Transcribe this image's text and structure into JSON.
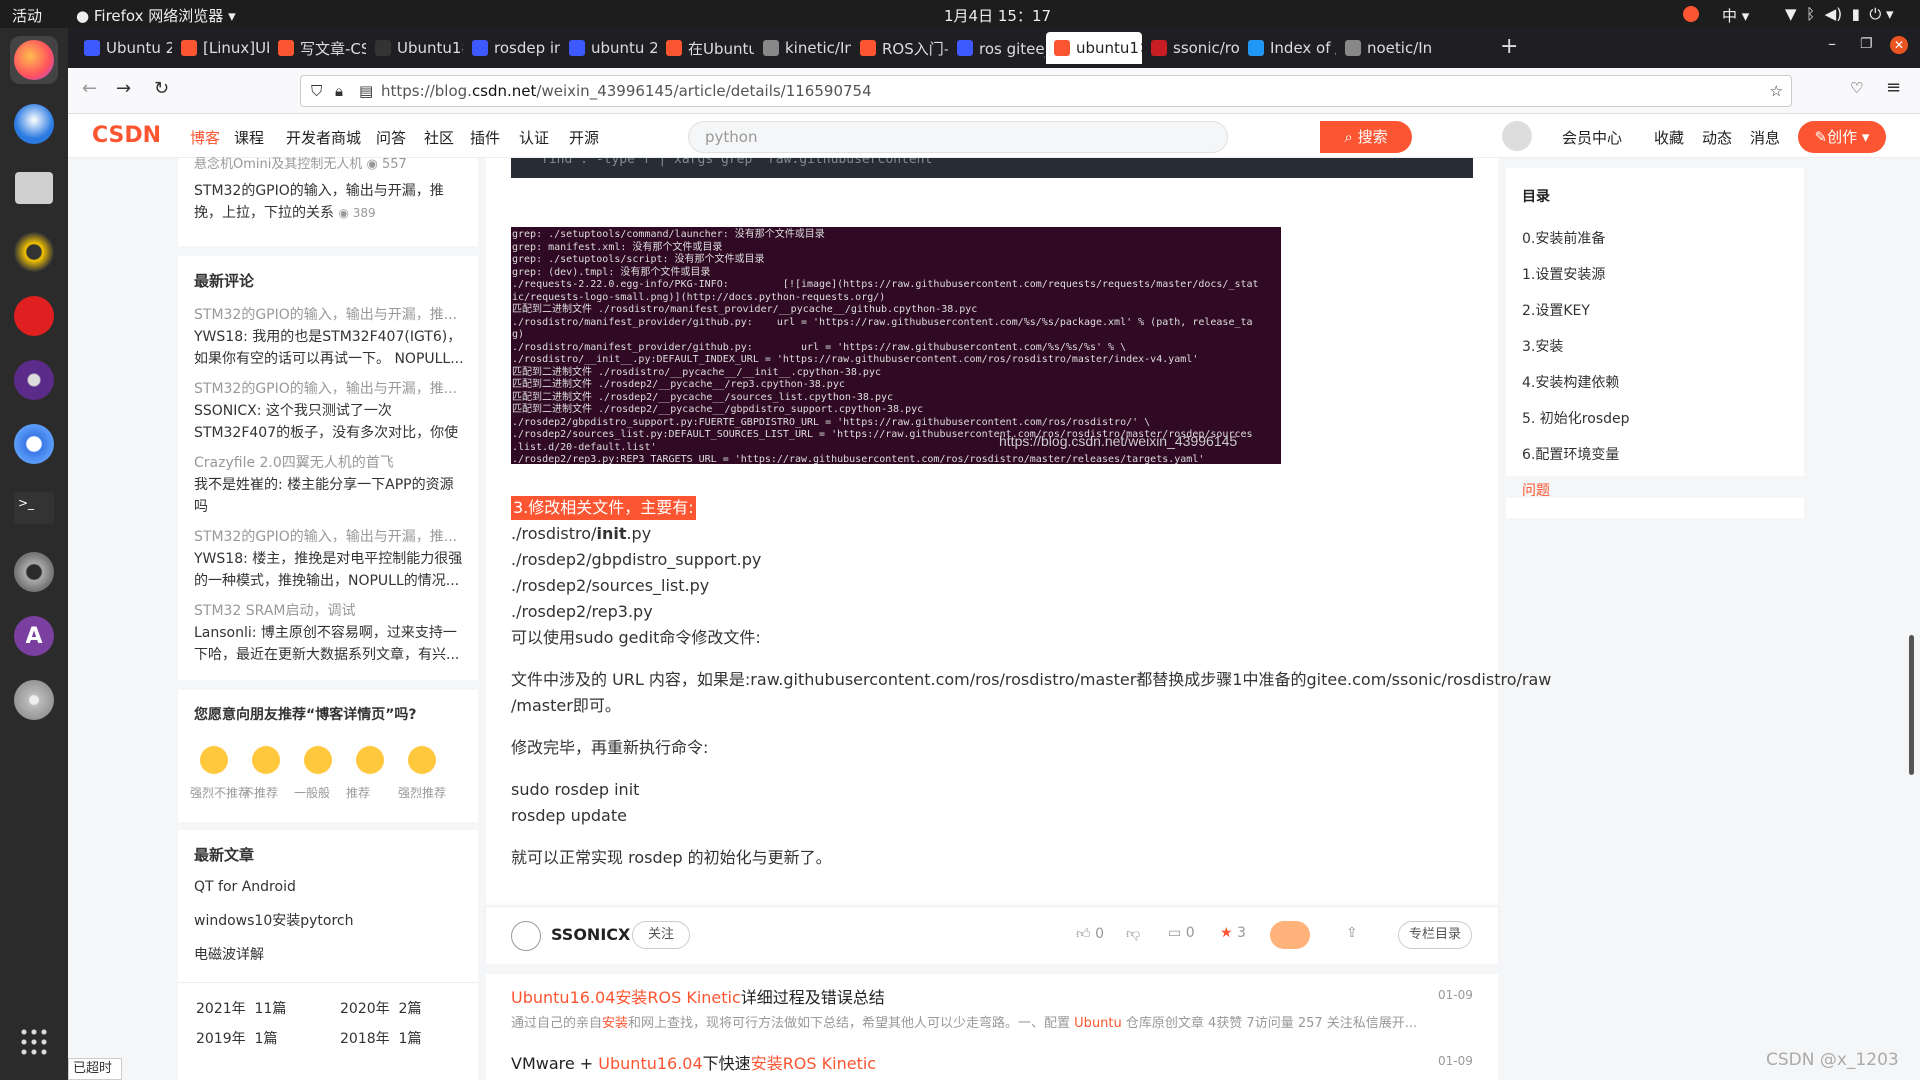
{
  "system": {
    "activities": "活动",
    "app_name": "Firefox 网络浏览器",
    "datetime": "1月4日 15：17",
    "input_method": "中"
  },
  "tabs": [
    {
      "label": "Ubuntu 20.",
      "color": "#3d5afe",
      "icon": "globe-icon"
    },
    {
      "label": "[Linux]Ubu",
      "color": "#fc5531",
      "icon": "csdn-icon"
    },
    {
      "label": "写文章-CSD",
      "color": "#fc5531",
      "icon": "csdn-icon"
    },
    {
      "label": "Ubuntu18.0",
      "color": "#333",
      "icon": "none"
    },
    {
      "label": "rosdep init",
      "color": "#3d5afe",
      "icon": "baidu-icon"
    },
    {
      "label": "ubuntu 20.0",
      "color": "#3d5afe",
      "icon": "baidu-icon"
    },
    {
      "label": "在Ubuntu2",
      "color": "#fc5531",
      "icon": "csdn-icon"
    },
    {
      "label": "kinetic/Inst",
      "color": "#888",
      "icon": "grid-icon"
    },
    {
      "label": "ROS入门—",
      "color": "#fc5531",
      "icon": "csdn-icon"
    },
    {
      "label": "ros gitee_百",
      "color": "#3d5afe",
      "icon": "baidu-icon"
    },
    {
      "label": "ubuntu1",
      "color": "#fc5531",
      "icon": "csdn-icon"
    },
    {
      "label": "ssonic/rosd",
      "color": "#c71d23",
      "icon": "gitee-icon"
    },
    {
      "label": "Index of /r",
      "color": "#2196f3",
      "icon": "ros-icon"
    },
    {
      "label": "noetic/Inst",
      "color": "#888",
      "icon": "grid-icon"
    }
  ],
  "url": {
    "prefix": "https://blog.",
    "domain": "csdn.net",
    "path": "/weixin_43996145/article/details/116590754"
  },
  "csdn_nav": {
    "logo": "CSDN",
    "items": [
      "博客",
      "课程",
      "开发者商城",
      "问答",
      "社区",
      "插件",
      "认证",
      "开源"
    ],
    "search_placeholder": "python",
    "search_button": "搜索",
    "right": [
      "会员中心",
      "收藏",
      "动态",
      "消息"
    ],
    "create": "创作"
  },
  "sidebar": {
    "top_items": [
      {
        "title": "悬念机Omini及其控制无人机",
        "views": "557"
      },
      {
        "title": "STM32的GPIO的输入，输出与开漏，推挽，上拉，下拉的关系",
        "views": "389"
      }
    ],
    "comments_heading": "最新评论",
    "comments": [
      {
        "article": "STM32的GPIO的输入，输出与开漏，推...",
        "text": "YWS18: 我用的也是STM32F407(IGT6)，如果你有空的话可以再试一下。 NOPULL..."
      },
      {
        "article": "STM32的GPIO的输入，输出与开漏，推...",
        "text": "SSONICX: 这个我只测试了一次STM32F407的板子，没有多次对比，你使用的是什么..."
      },
      {
        "article": "Crazyfile 2.0四翼无人机的首飞",
        "text": "我不是姓崔的: 楼主能分享一下APP的资源吗"
      },
      {
        "article": "STM32的GPIO的输入，输出与开漏，推...",
        "text": "YWS18: 楼主，推挽是对电平控制能力很强的一种模式，推挽输出，NOPULL的情况..."
      },
      {
        "article": "STM32 SRAM启动，调试",
        "text": "Lansonli: 博主原创不容易啊，过来支持一下哈，最近在更新大数据系列文章，有兴..."
      }
    ],
    "recommend_heading": "您愿意向朋友推荐“博客详情页”吗?",
    "recommend_options": [
      "强烈不推荐",
      "不推荐",
      "一般般",
      "推荐",
      "强烈推荐"
    ],
    "articles_heading": "最新文章",
    "articles": [
      "QT for Android",
      "windows10安装pytorch",
      "电磁波详解"
    ],
    "archives": [
      {
        "label": "2021年",
        "count": "11篇"
      },
      {
        "label": "2020年",
        "count": "2篇"
      },
      {
        "label": "2019年",
        "count": "1篇"
      },
      {
        "label": "2018年",
        "count": "1篇"
      }
    ]
  },
  "code_line": "find . -type f | xargs grep 'raw.githubusercontent'",
  "terminal_lines": [
    "grep: ./setuptools/command/launcher: 没有那个文件或目录",
    "grep: manifest.xml: 没有那个文件或目录",
    "grep: ./setuptools/script: 没有那个文件或目录",
    "grep: (dev).tmpl: 没有那个文件或目录",
    "./requests-2.22.0.egg-info/PKG-INFO:         [![image](https://raw.githubusercontent.com/requests/requests/master/docs/_stat",
    "ic/requests-logo-small.png)](http://docs.python-requests.org/)",
    "匹配到二进制文件 ./rosdistro/manifest_provider/__pycache__/github.cpython-38.pyc",
    "./rosdistro/manifest_provider/github.py:    url = 'https://raw.githubusercontent.com/%s/%s/package.xml' % (path, release_ta",
    "g)",
    "./rosdistro/manifest_provider/github.py:        url = 'https://raw.githubusercontent.com/%s/%s/%s' % \\",
    "./rosdistro/__init__.py:DEFAULT_INDEX_URL = 'https://raw.githubusercontent.com/ros/rosdistro/master/index-v4.yaml'",
    "匹配到二进制文件 ./rosdistro/__pycache__/__init__.cpython-38.pyc",
    "匹配到二进制文件 ./rosdep2/__pycache__/rep3.cpython-38.pyc",
    "匹配到二进制文件 ./rosdep2/__pycache__/sources_list.cpython-38.pyc",
    "匹配到二进制文件 ./rosdep2/__pycache__/gbpdistro_support.cpython-38.pyc",
    "./rosdep2/gbpdistro_support.py:FUERTE_GBPDISTRO_URL = 'https://raw.githubusercontent.com/ros/rosdistro/' \\",
    "./rosdep2/sources_list.py:DEFAULT_SOURCES_LIST_URL = 'https://raw.githubusercontent.com/ros/rosdistro/master/rosdep/sources",
    ".list.d/20-default.list'",
    "./rosdep2/rep3.py:REP3_TARGETS_URL = 'https://raw.githubusercontent.com/ros/rosdistro/master/releases/targets.yaml'"
  ],
  "terminal_watermark": "https://blog.csdn.net/weixin_43996145",
  "article": {
    "step_heading": "3.修改相关文件，主要有:",
    "files": [
      "./rosdistro/",
      "init",
      ".py",
      "./rosdep2/gbpdistro_support.py",
      "./rosdep2/sources_list.py",
      "./rosdep2/rep3.py"
    ],
    "p1": "可以使用sudo gedit命令修改文件:",
    "p2a": "文件中涉及的 URL 内容，如果是:raw.githubusercontent.com/ros/rosdistro/master都替换成步骤1中准备的gitee.com/ssonic/rosdistro/raw",
    "p2b": "/master即可。",
    "p3": "修改完毕，再重新执行命令:",
    "cmd1": "sudo rosdep init",
    "cmd2": "rosdep update",
    "p4": "就可以正常实现 rosdep 的初始化与更新了。"
  },
  "author": {
    "name": "SSONICX",
    "follow": "关注",
    "likes": "0",
    "comments": "0",
    "favorites": "3",
    "column": "专栏目录"
  },
  "toc": {
    "heading": "目录",
    "items": [
      "0.安装前准备",
      "1.设置安装源",
      "2.设置KEY",
      "3.安装",
      "4.安装构建依赖",
      "5. 初始化rosdep",
      "6.配置环境变量",
      "问题"
    ]
  },
  "related": [
    {
      "t1": "Ubuntu16.04安装ROS Kinetic",
      "t2": "详细过程及错误总结",
      "date": "01-09",
      "desc": "通过自己的亲自",
      "desc_red": "安装",
      "desc2": "和网上查找，现将可行方法做如下总结，希望其他人可以少走弯路。一、配置 ",
      "desc_red2": "Ubuntu",
      "desc3": " 仓库原创文章 4获赞 7访问量 257 关注私信展开..."
    },
    {
      "t0": "VMware + ",
      "t1": "Ubuntu16.04",
      "t2": "下快速",
      "t3": "安装ROS Kinetic",
      "date": "01-09"
    }
  ],
  "status": "已超时",
  "watermark": "CSDN @x_1203",
  "colors": {
    "accent": "#fc5531",
    "terminal_bg": "#300a24",
    "dark_bar": "#1d1d1d"
  }
}
